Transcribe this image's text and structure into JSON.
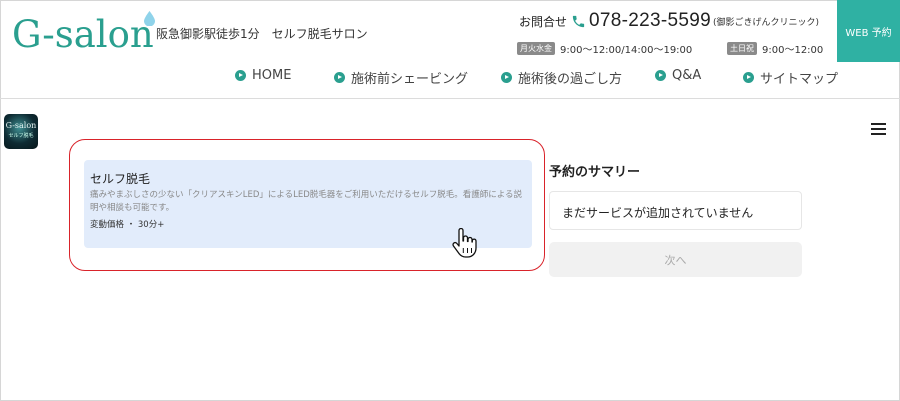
{
  "header": {
    "logo": "G-salon",
    "tagline": "阪急御影駅徒歩1分　セルフ脱毛サロン",
    "contact_label": "お問合せ",
    "phone": "078-223-5599",
    "clinic": "(御影ごきげんクリニック)",
    "hours": [
      {
        "days": "月火水金",
        "time": "9:00～12:00/14:00～19:00"
      },
      {
        "days": "土日祝",
        "time": "9:00～12:00"
      }
    ],
    "web_button": "WEB 予約"
  },
  "nav": {
    "items": [
      "HOME",
      "施術前シェービング",
      "施術後の過ごし方",
      "Q&A",
      "サイトマップ"
    ]
  },
  "app": {
    "logo_text": "G-salon",
    "logo_sub": "セルフ脱毛"
  },
  "service": {
    "title": "セルフ脱毛",
    "description": "痛みやまぶしさの少ない「クリアスキンLED」によるLED脱毛器をご利用いただけるセルフ脱毛。看護師による説明や相談も可能です。",
    "meta": "変動価格 ・ 30分+"
  },
  "summary": {
    "title": "予約のサマリー",
    "empty_text": "まだサービスが追加されていません",
    "next_label": "次へ"
  },
  "colors": {
    "brand": "#2a9f8f",
    "web_button": "#2fb1a3",
    "card": "#e2ecfb",
    "highlight": "#d9232a"
  }
}
